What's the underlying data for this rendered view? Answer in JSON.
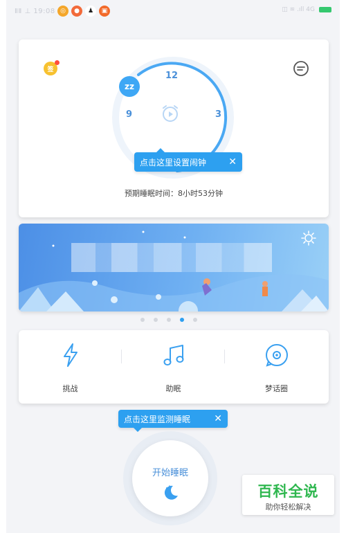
{
  "status_bar": {
    "left_text": "ⅡⅡ ⊥ 19:08",
    "right_text": "◫ ≋ .ıll 4G",
    "app_icons": [
      {
        "name": "colorwheel-app-icon",
        "color": "#f4a62a"
      },
      {
        "name": "chat-app-icon",
        "color": "#f26a3a"
      },
      {
        "name": "penguin-app-icon",
        "color": "#222222"
      },
      {
        "name": "orange-app-icon",
        "color": "#f26a2a"
      }
    ],
    "battery_color": "#35c86f"
  },
  "alarm_card": {
    "vip_badge": "签",
    "clock_numbers": {
      "twelve": "12",
      "nine": "9",
      "three": "3"
    },
    "zz_badge": "zz",
    "tip_text": "点击这里设置闹钟",
    "tip_close": "✕",
    "expected_sleep": "预期睡眠时间：8小时53分钟"
  },
  "banner": {
    "pagination_count": 5,
    "active_index": 3
  },
  "tools": [
    {
      "label": "挑战",
      "icon": "lightning-icon"
    },
    {
      "label": "助眠",
      "icon": "music-note-icon"
    },
    {
      "label": "梦话圈",
      "icon": "dream-circle-icon"
    }
  ],
  "sleep": {
    "tip_text": "点击这里监测睡眠",
    "tip_close": "✕",
    "start_label": "开始睡眠"
  },
  "watermark": {
    "title": "百科全说",
    "subtitle": "助你轻松解决"
  },
  "colors": {
    "accent": "#2da0f0",
    "text_blue": "#4a90d9",
    "brand_green": "#2fb74f"
  }
}
